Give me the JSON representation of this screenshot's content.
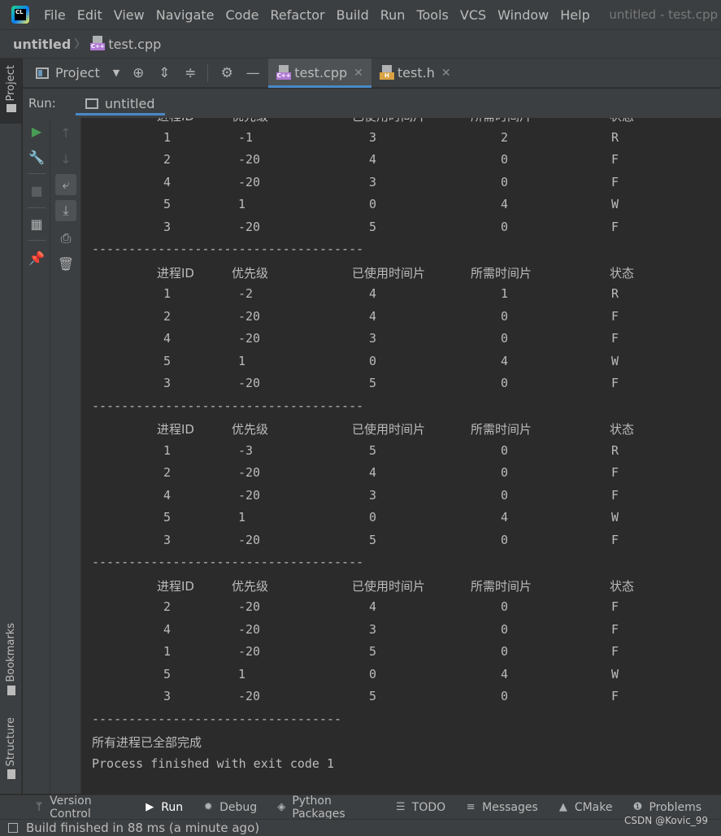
{
  "menubar": {
    "items": [
      "File",
      "Edit",
      "View",
      "Navigate",
      "Code",
      "Refactor",
      "Build",
      "Run",
      "Tools",
      "VCS",
      "Window",
      "Help"
    ],
    "window_title": "untitled - test.cpp"
  },
  "navbar": {
    "project": "untitled",
    "file": "test.cpp"
  },
  "left_strip": {
    "project": "Project",
    "bookmarks": "Bookmarks",
    "structure": "Structure"
  },
  "tool_row": {
    "project_label": "Project",
    "tabs": [
      {
        "label": "test.cpp",
        "icon": "cpp-file-icon",
        "active": true
      },
      {
        "label": "test.h",
        "icon": "header-file-icon",
        "active": false
      }
    ]
  },
  "run": {
    "label": "Run:",
    "tab": "untitled"
  },
  "console": {
    "top_partial_header": [
      "进程ID",
      "优先级",
      "已使用时间片",
      "所需时间片",
      "状态"
    ],
    "blocks": [
      {
        "header": null,
        "rows": [
          [
            "1",
            "-1",
            "3",
            "2",
            "R"
          ],
          [
            "2",
            "-20",
            "4",
            "0",
            "F"
          ],
          [
            "4",
            "-20",
            "3",
            "0",
            "F"
          ],
          [
            "5",
            "1",
            "0",
            "4",
            "W"
          ],
          [
            "3",
            "-20",
            "5",
            "0",
            "F"
          ]
        ],
        "separator": "-------------------------------------"
      },
      {
        "header": [
          "进程ID",
          "优先级",
          "已使用时间片",
          "所需时间片",
          "状态"
        ],
        "rows": [
          [
            "1",
            "-2",
            "4",
            "1",
            "R"
          ],
          [
            "2",
            "-20",
            "4",
            "0",
            "F"
          ],
          [
            "4",
            "-20",
            "3",
            "0",
            "F"
          ],
          [
            "5",
            "1",
            "0",
            "4",
            "W"
          ],
          [
            "3",
            "-20",
            "5",
            "0",
            "F"
          ]
        ],
        "separator": "-------------------------------------"
      },
      {
        "header": [
          "进程ID",
          "优先级",
          "已使用时间片",
          "所需时间片",
          "状态"
        ],
        "rows": [
          [
            "1",
            "-3",
            "5",
            "0",
            "R"
          ],
          [
            "2",
            "-20",
            "4",
            "0",
            "F"
          ],
          [
            "4",
            "-20",
            "3",
            "0",
            "F"
          ],
          [
            "5",
            "1",
            "0",
            "4",
            "W"
          ],
          [
            "3",
            "-20",
            "5",
            "0",
            "F"
          ]
        ],
        "separator": "-------------------------------------"
      },
      {
        "header": [
          "进程ID",
          "优先级",
          "已使用时间片",
          "所需时间片",
          "状态"
        ],
        "rows": [
          [
            "2",
            "-20",
            "4",
            "0",
            "F"
          ],
          [
            "4",
            "-20",
            "3",
            "0",
            "F"
          ],
          [
            "1",
            "-20",
            "5",
            "0",
            "F"
          ],
          [
            "5",
            "1",
            "0",
            "4",
            "W"
          ],
          [
            "3",
            "-20",
            "5",
            "0",
            "F"
          ]
        ],
        "separator": "----------------------------------"
      }
    ],
    "done_message": "所有进程已全部完成",
    "exit_message": "Process finished with exit code 1"
  },
  "bottom_tabs": [
    {
      "label": "Version Control",
      "icon": "branch-icon"
    },
    {
      "label": "Run",
      "icon": "run-icon",
      "active": true
    },
    {
      "label": "Debug",
      "icon": "bug-icon"
    },
    {
      "label": "Python Packages",
      "icon": "layers-icon"
    },
    {
      "label": "TODO",
      "icon": "list-icon"
    },
    {
      "label": "Messages",
      "icon": "messages-icon"
    },
    {
      "label": "CMake",
      "icon": "cmake-icon"
    },
    {
      "label": "Problems",
      "icon": "warning-icon"
    }
  ],
  "status": {
    "text": "Build finished in 88 ms (a minute ago)"
  },
  "watermark": "CSDN @Kovic_99",
  "colors": {
    "background": "#2b2b2b",
    "panel": "#3c3f41",
    "text": "#bbbbbb",
    "run_green": "#499c54",
    "accent": "#4a88c7"
  }
}
